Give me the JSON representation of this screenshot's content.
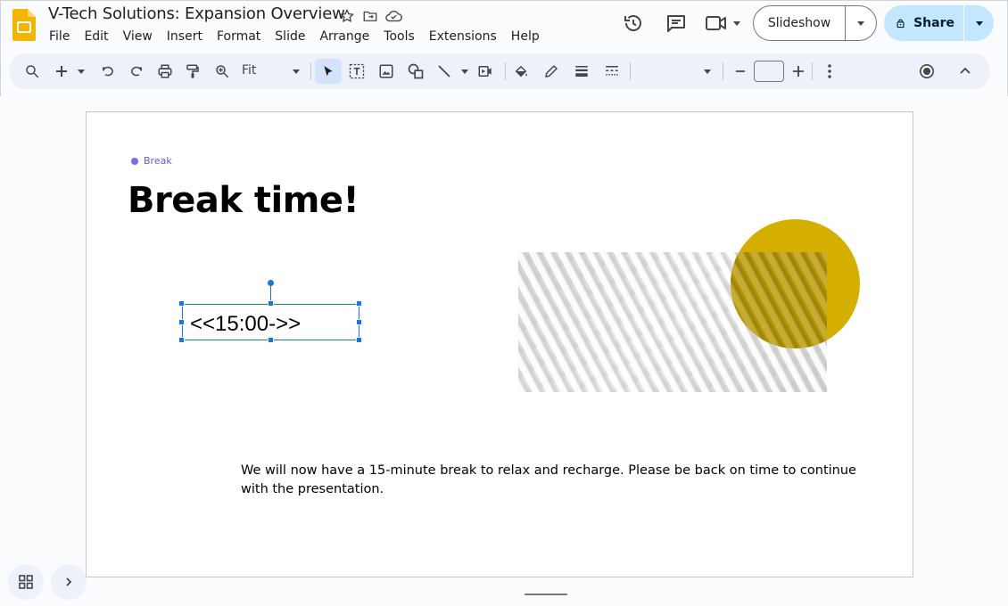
{
  "app": {
    "title": "V-Tech Solutions: Expansion Overview",
    "menu": [
      "File",
      "Edit",
      "View",
      "Insert",
      "Format",
      "Slide",
      "Arrange",
      "Tools",
      "Extensions",
      "Help"
    ],
    "slideshow_label": "Slideshow",
    "share_label": "Share"
  },
  "toolbar": {
    "zoom_value": "Fit",
    "icons": [
      "search-icon",
      "add-icon",
      "undo-icon",
      "redo-icon",
      "print-icon",
      "paint-format-icon",
      "zoom-icon",
      "select-icon",
      "text-box-icon",
      "image-icon",
      "shape-icon",
      "line-icon",
      "video-icon",
      "fill-color-icon",
      "border-color-icon",
      "border-weight-icon",
      "border-dash-icon",
      "minus-icon",
      "plus-icon",
      "more-icon",
      "record-icon",
      "collapse-icon"
    ]
  },
  "slide": {
    "tag": "Break",
    "title": "Break time!",
    "timer_text": "<<15:00->>",
    "body": "We will now have a 15-minute break to relax and recharge. Please be back on time to continue with the presentation."
  },
  "colors": {
    "accent": "#1a73e8",
    "tag_dot": "#7b68ee",
    "circle": "#d4af00",
    "share_bg": "#c2e7ff",
    "toolbar_bg": "#edf2fa"
  }
}
